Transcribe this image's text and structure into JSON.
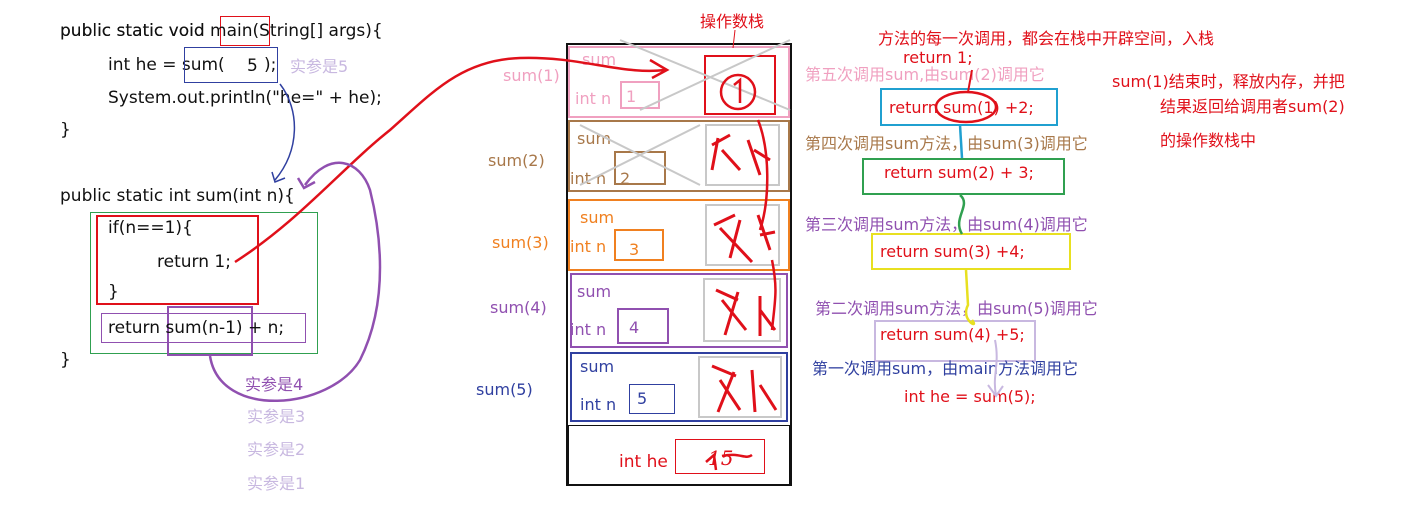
{
  "code": {
    "main_line1": "public static void main(String[] args){",
    "main_line2_prefix": "int he = sum(",
    "main_line2_arg": "5",
    "main_line2_suffix": ");",
    "main_actual_param": "实参是5",
    "main_line3": "System.out.println(\"he=\" + he);",
    "close1": "}",
    "sum_line1": "public static int sum(int n){",
    "sum_if": "if(n==1){",
    "sum_return1": "return 1;",
    "sum_close_if": "}",
    "sum_return_rec": "return sum(n-1) + n;",
    "close2": "}"
  },
  "actual_params": [
    "实参是4",
    "实参是3",
    "实参是2",
    "实参是1"
  ],
  "stack": {
    "title": "操作数栈",
    "frames": [
      {
        "label": "sum(1)",
        "name": "sum",
        "var": "int n",
        "value": "1",
        "color": "#f0a0c0",
        "note": "第五次调用sum,由sum(2)调用它"
      },
      {
        "label": "sum(2)",
        "name": "sum",
        "var": "int n",
        "value": "2",
        "color": "#a8784a",
        "note": "第四次调用sum方法，由sum(3)调用它"
      },
      {
        "label": "sum(3)",
        "name": "sum",
        "var": "int n",
        "value": "3",
        "color": "#f08020",
        "note": "第三次调用sum方法，由sum(4)调用它"
      },
      {
        "label": "sum(4)",
        "name": "sum",
        "var": "int n",
        "value": "4",
        "color": "#9050b0",
        "note": "第二次调用sum方法，由sum(5)调用它"
      },
      {
        "label": "sum(5)",
        "name": "sum",
        "var": "int n",
        "value": "5",
        "color": "#3040a0",
        "note": "第一次调用sum，由main方法调用它"
      }
    ],
    "main_frame": {
      "var": "int he",
      "value": "15"
    }
  },
  "right": {
    "headline": "方法的每一次调用，都会在栈中开辟空间，入栈",
    "ret1": "return 1;",
    "ret2": "return sum(1) +2;",
    "ret3": "return sum(2) + 3;",
    "ret4": "return sum(3) +4;",
    "ret5": "return sum(4) +5;",
    "ret6": "int he = sum(5);",
    "release_line1": "sum(1)结束时，释放内存，并把",
    "release_line2": "结果返回给调用者sum(2)",
    "release_line3": "的操作数栈中"
  },
  "colors": {
    "red": "#e0101a",
    "pink": "#f0a0c0",
    "brown": "#a8784a",
    "orange": "#f08020",
    "purple": "#9050b0",
    "navy": "#3040a0",
    "green": "#30a050",
    "cyan": "#20a0d0",
    "yellow": "#e8e020",
    "lavender": "#c8b8e0"
  }
}
